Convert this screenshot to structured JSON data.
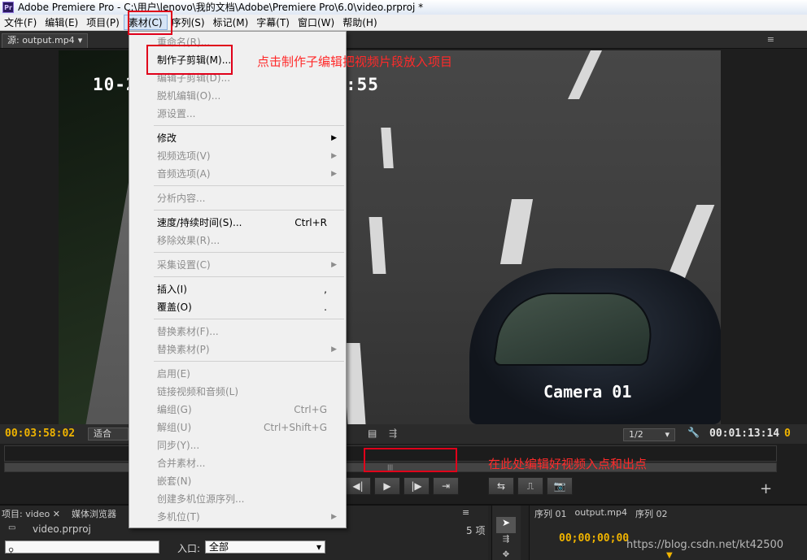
{
  "window": {
    "title": "Adobe Premiere Pro - C:\\用户\\lenovo\\我的文档\\Adobe\\Premiere Pro\\6.0\\video.prproj *",
    "app_icon": "Pr"
  },
  "menubar": [
    "文件(F)",
    "编辑(E)",
    "项目(P)",
    "素材(C)",
    "序列(S)",
    "标记(M)",
    "字幕(T)",
    "窗口(W)",
    "帮助(H)"
  ],
  "active_menu": "素材(C)",
  "source_panel": {
    "tab_label": "源: output.mp4",
    "overlay_timestamp": "10-2",
    "overlay_time_tail": ":55",
    "camera_label": "Camera 01",
    "current_time": "00:03:58:02",
    "fit_label": "适合",
    "resolution": "1/2",
    "duration": "00:01:13:14"
  },
  "dropdown": [
    {
      "label": "重命名(R)...",
      "enabled": false
    },
    {
      "label": "制作子剪辑(M)...",
      "enabled": true
    },
    {
      "label": "编辑子剪辑(D)...",
      "enabled": false
    },
    {
      "label": "脱机编辑(O)...",
      "enabled": false
    },
    {
      "label": "源设置...",
      "enabled": false
    },
    {
      "label": "修改",
      "enabled": true,
      "submenu": true
    },
    {
      "label": "视频选项(V)",
      "enabled": false,
      "submenu": true
    },
    {
      "label": "音频选项(A)",
      "enabled": false,
      "submenu": true
    },
    {
      "label": "分析内容...",
      "enabled": false
    },
    {
      "label": "速度/持续时间(S)...",
      "enabled": true,
      "shortcut": "Ctrl+R"
    },
    {
      "label": "移除效果(R)...",
      "enabled": false
    },
    {
      "label": "采集设置(C)",
      "enabled": false,
      "submenu": true
    },
    {
      "label": "插入(I)",
      "enabled": true,
      "shortcut": ","
    },
    {
      "label": "覆盖(O)",
      "enabled": true,
      "shortcut": "."
    },
    {
      "label": "替换素材(F)...",
      "enabled": false
    },
    {
      "label": "替换素材(P)",
      "enabled": false,
      "submenu": true
    },
    {
      "label": "启用(E)",
      "enabled": false
    },
    {
      "label": "链接视频和音频(L)",
      "enabled": false
    },
    {
      "label": "编组(G)",
      "enabled": false,
      "shortcut": "Ctrl+G"
    },
    {
      "label": "解组(U)",
      "enabled": false,
      "shortcut": "Ctrl+Shift+G"
    },
    {
      "label": "同步(Y)...",
      "enabled": false
    },
    {
      "label": "合并素材...",
      "enabled": false
    },
    {
      "label": "嵌套(N)",
      "enabled": false
    },
    {
      "label": "创建多机位源序列...",
      "enabled": false
    },
    {
      "label": "多机位(T)",
      "enabled": false,
      "submenu": true
    }
  ],
  "annotations": {
    "subclip_note": "点击制作子编辑把视频片段放入项目",
    "inout_note": "在此处编辑好视频入点和出点"
  },
  "project_panel": {
    "tab_project": "项目: video",
    "tab_media": "媒体浏览器",
    "filename": "video.prproj",
    "count": "5 项",
    "in_label": "入口:",
    "in_value": "全部"
  },
  "sequence_panel": {
    "tabs": [
      "序列 01",
      "output.mp4",
      "序列 02"
    ],
    "timecode": "00;00;00;00"
  },
  "watermark": "https://blog.csdn.net/kt42500",
  "colors": {
    "accent_timecode": "#f0b400",
    "annotation_red": "#e0001a"
  }
}
